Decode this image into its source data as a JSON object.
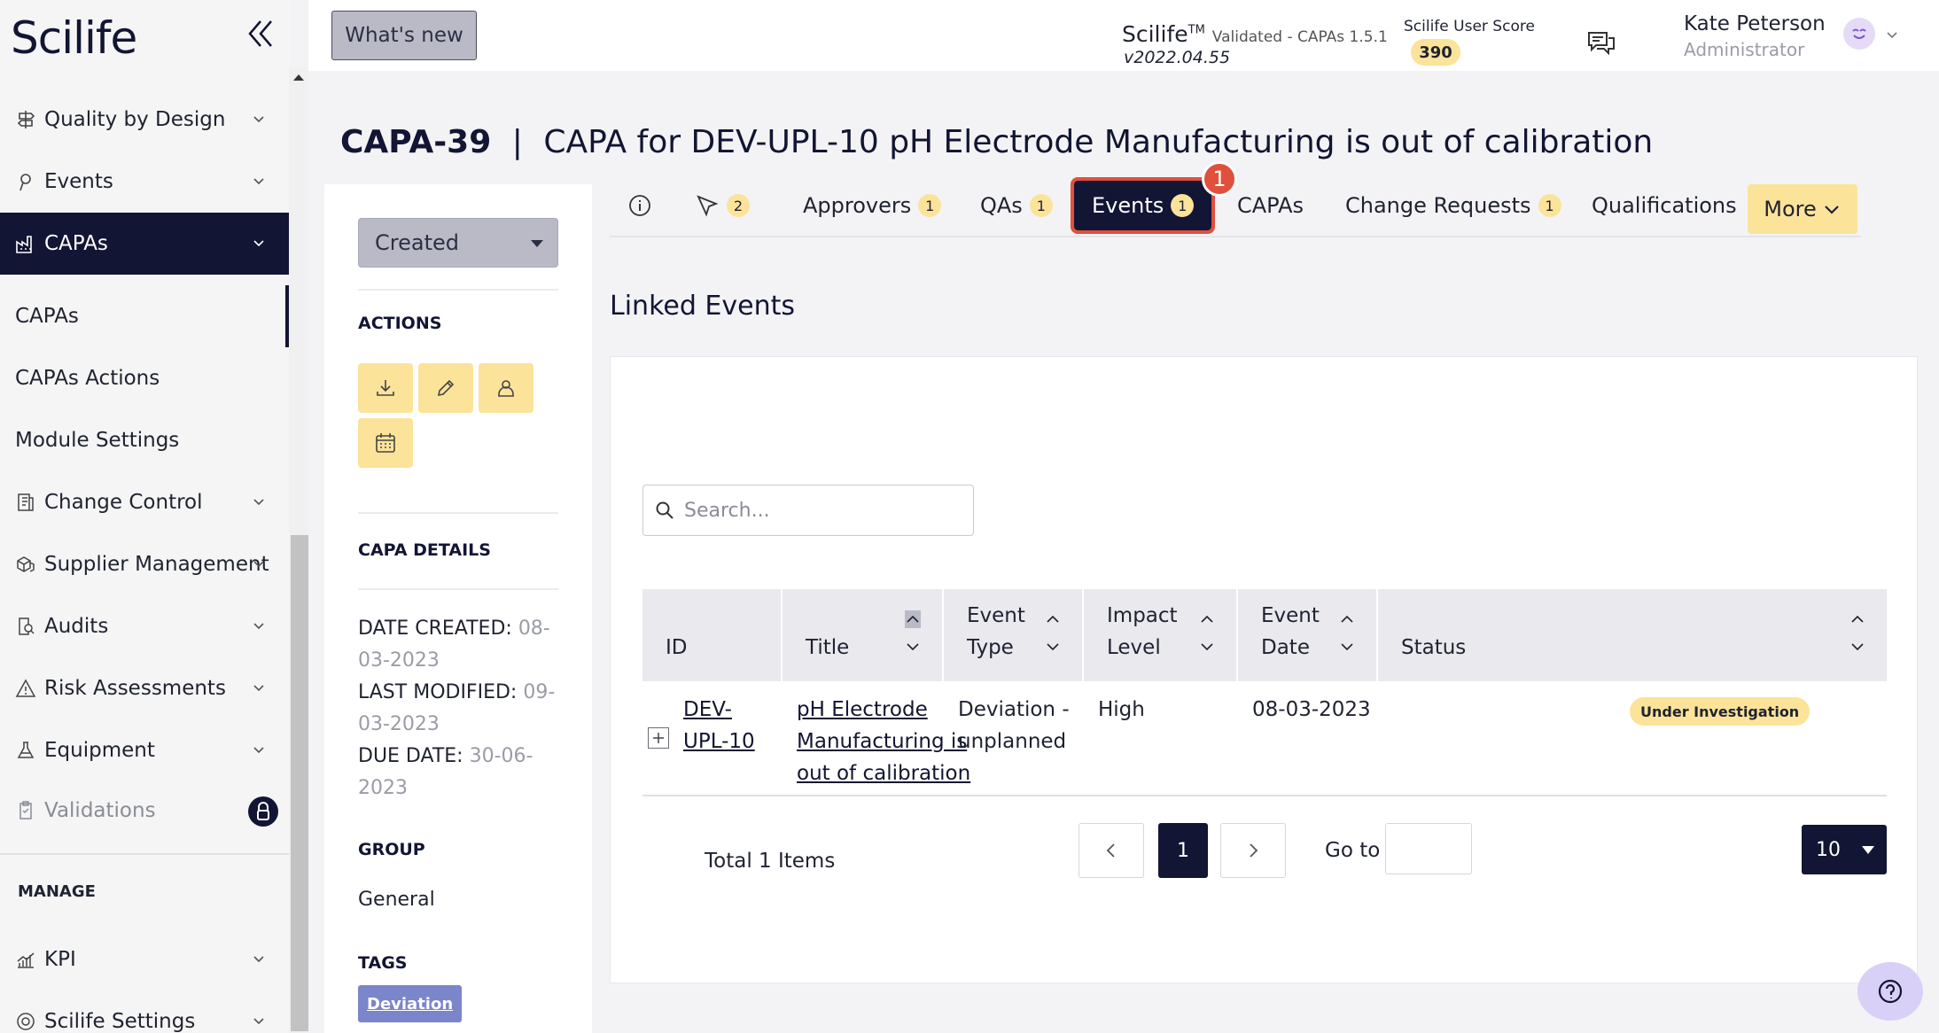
{
  "app": {
    "brand": "Scilife"
  },
  "header": {
    "whats_new": "What's new",
    "product": "Scilife",
    "trademark": "TM",
    "validated": "Validated - CAPAs 1.5.1",
    "version": "v2022.04.55",
    "score_label": "Scilife User Score",
    "score_value": "390",
    "user_name": "Kate Peterson",
    "user_role": "Administrator"
  },
  "sidebar": {
    "items": [
      {
        "label": "Quality by Design",
        "icon": "signpost-icon"
      },
      {
        "label": "Events",
        "icon": "location-pin-icon"
      },
      {
        "label": "CAPAs",
        "icon": "factory-icon"
      },
      {
        "label": "CAPAs"
      },
      {
        "label": "CAPAs Actions"
      },
      {
        "label": "Module Settings"
      },
      {
        "label": "Change Control",
        "icon": "document-icon"
      },
      {
        "label": "Supplier Management",
        "icon": "boxes-icon"
      },
      {
        "label": "Audits",
        "icon": "audit-icon"
      },
      {
        "label": "Risk Assessments",
        "icon": "warning-icon"
      },
      {
        "label": "Equipment",
        "icon": "flask-icon"
      },
      {
        "label": "Validations",
        "icon": "clipboard-icon"
      }
    ],
    "manage_heading": "MANAGE",
    "manage_items": [
      {
        "label": "KPI",
        "icon": "bar-chart-icon"
      },
      {
        "label": "Scilife Settings",
        "icon": "settings-icon"
      }
    ]
  },
  "page": {
    "record_id": "CAPA-39",
    "separator": "|",
    "record_title": "CAPA for DEV-UPL-10 pH Electrode Manufacturing is out of calibration"
  },
  "panel": {
    "status": "Created",
    "actions_heading": "ACTIONS",
    "details_heading": "CAPA DETAILS",
    "date_created_label": "DATE CREATED:",
    "date_created": "08-03-2023",
    "last_modified_label": "LAST MODIFIED:",
    "last_modified": "09-03-2023",
    "due_date_label": "DUE DATE:",
    "due_date": "30-06-2023",
    "group_heading": "GROUP",
    "group": "General",
    "tags_heading": "TAGS",
    "tag": "Deviation"
  },
  "tabs": {
    "info_count": "",
    "flow_count": "2",
    "approvers": "Approvers",
    "approvers_count": "1",
    "qas": "QAs",
    "qas_count": "1",
    "events": "Events",
    "events_count": "1",
    "capas": "CAPAs",
    "change_requests": "Change Requests",
    "change_requests_count": "1",
    "qualifications": "Qualifications",
    "more": "More",
    "step_marker": "1"
  },
  "linked_events": {
    "title": "Linked Events",
    "search_placeholder": "Search...",
    "columns": [
      {
        "l1": "",
        "l2": "ID"
      },
      {
        "l1": "",
        "l2": "Title"
      },
      {
        "l1": "Event",
        "l2": "Type"
      },
      {
        "l1": "Impact",
        "l2": "Level"
      },
      {
        "l1": "Event",
        "l2": "Date"
      },
      {
        "l1": "",
        "l2": "Status"
      }
    ],
    "rows": [
      {
        "id_l1": "DEV-",
        "id_l2": "UPL-10",
        "title_l1": "pH Electrode",
        "title_l2": "Manufacturing is",
        "title_l3": "out of calibration",
        "type_l1": "Deviation -",
        "type_l2": "unplanned",
        "impact": "High",
        "date": "08-03-2023",
        "status": "Under Investigation"
      }
    ],
    "total": "Total 1 Items",
    "current_page": "1",
    "goto_label": "Go to",
    "page_size": "10"
  }
}
